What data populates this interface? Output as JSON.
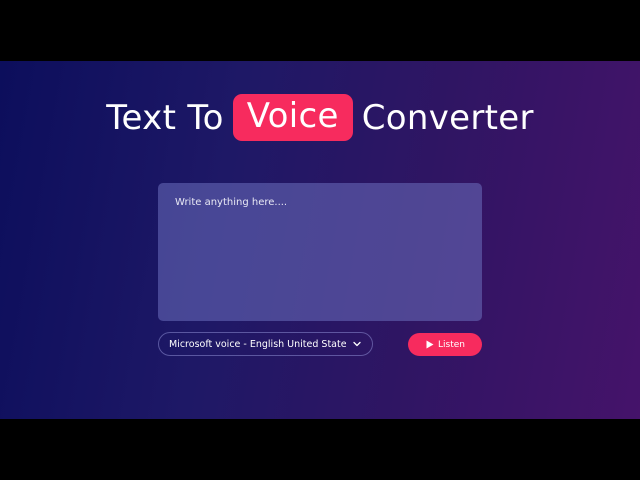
{
  "header": {
    "title_before": "Text To",
    "title_highlight": "Voice",
    "title_after": "Converter"
  },
  "editor": {
    "placeholder": "Write anything here....",
    "value": ""
  },
  "voice_select": {
    "selected": "Microsoft voice - English United States",
    "icon": "chevron-down-icon"
  },
  "listen_button": {
    "label": "Listen",
    "icon": "play-icon"
  },
  "colors": {
    "accent": "#f72b5e",
    "text": "#ffffff",
    "bg_start": "#0c0e5c",
    "bg_end": "#45136a"
  }
}
